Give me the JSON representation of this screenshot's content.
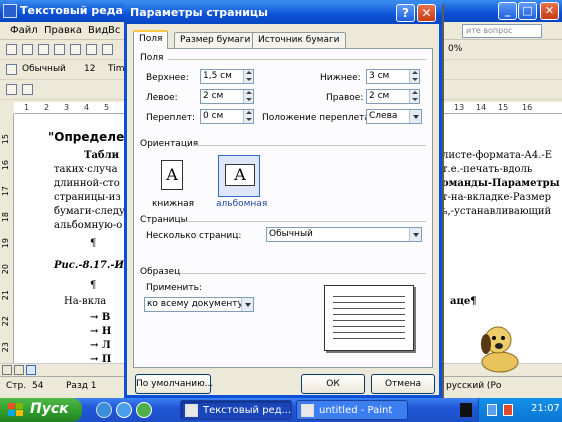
{
  "word": {
    "title": "Текстовый редакто",
    "menu": [
      "Файл",
      "Правка",
      "Вид",
      "Вс"
    ],
    "help_placeholder": "ите вопрос",
    "toolbar": {
      "style": "Обычный",
      "size": "12",
      "font": "Tim",
      "zoom": "0%"
    },
    "ruler": [
      "1",
      "2",
      "3",
      "4",
      "5",
      "13",
      "14",
      "15",
      "16"
    ],
    "vruler": [
      "15",
      "16",
      "17",
      "18",
      "19",
      "20",
      "21",
      "22",
      "23"
    ],
    "doc": {
      "heading": "\"Определе",
      "line1_left": "Табли",
      "line1_right": "листе-формата-А4.-Е",
      "line2_left": "таких·случа",
      "line2_right": "т.е.-печать-вдоль",
      "line3_left": "длинной-сто",
      "line3_right": "оманды-Параметры",
      "line4_left": "страницы-из",
      "line4_right": "т-на-вкладке-Размер",
      "line5_left": "бумаги-следу",
      "line5_right": "ь,-устанавливающий",
      "line6": "альбомную-о",
      "para1": "¶",
      "caption": "Рис.-8.17.-И",
      "para2": "¶",
      "line7_left": "На-вкла",
      "line7_right": "аце¶",
      "bullet1": "→ В",
      "bullet2": "→ Н",
      "bullet3": "→ Л",
      "bullet4": "→ П"
    },
    "status": {
      "page": "Стр.",
      "page_num": "54",
      "section": "Разд 1",
      "lang": "русский (Ро"
    }
  },
  "dialog": {
    "title": "Параметры страницы",
    "tabs": [
      "Поля",
      "Размер бумаги",
      "Источник бумаги"
    ],
    "margins_group": "Поля",
    "top_label": "Верхнее:",
    "top_value": "1,5 см",
    "bottom_label": "Нижнее:",
    "bottom_value": "3 см",
    "left_label": "Левое:",
    "left_value": "2 см",
    "right_label": "Правое:",
    "right_value": "2 см",
    "gutter_label": "Переплет:",
    "gutter_value": "0 см",
    "gutter_pos_label": "Положение переплета:",
    "gutter_pos_value": "Слева",
    "orientation_group": "Ориентация",
    "portrait_label": "книжная",
    "landscape_label": "альбомная",
    "sheet_glyph": "A",
    "pages_group": "Страницы",
    "multiple_pages_label": "Несколько страниц:",
    "multiple_pages_value": "Обычный",
    "sample_group": "Образец",
    "apply_label": "Применить:",
    "apply_value": "ко всему документу",
    "default_button": "По умолчанию...",
    "ok_button": "ОК",
    "cancel_button": "Отмена"
  },
  "taskbar": {
    "start": "Пуск",
    "tasks": [
      "Текстовый ред...",
      "untitled - Paint"
    ],
    "clock": "21:07"
  }
}
